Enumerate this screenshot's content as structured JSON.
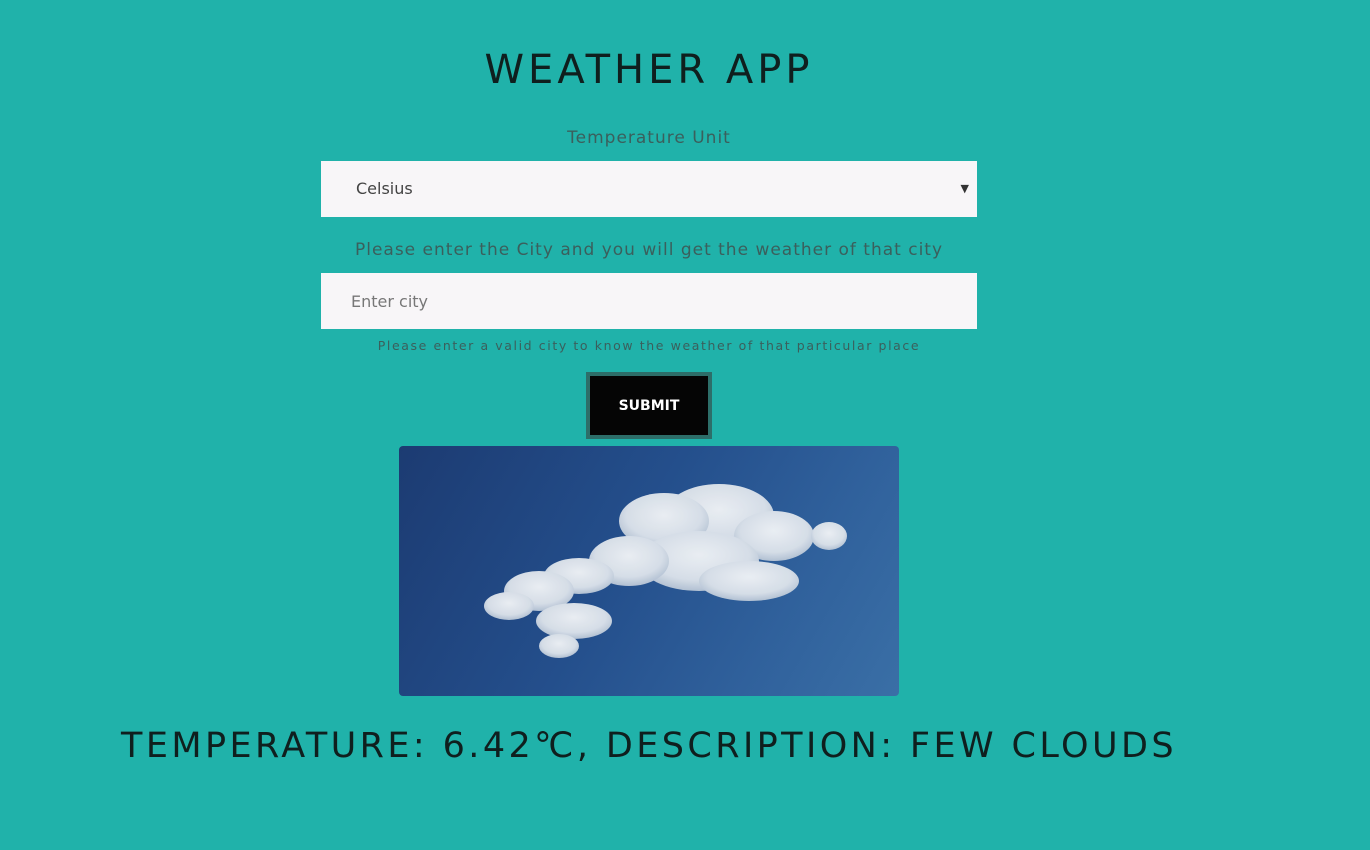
{
  "app": {
    "title": "WEATHER APP"
  },
  "unit": {
    "label": "Temperature Unit",
    "selected": "Celsius",
    "options": [
      "Celsius"
    ]
  },
  "city": {
    "label": "Please enter the City and you will get the weather of that city",
    "placeholder": "Enter city",
    "value": "",
    "hint": "Please enter a valid city to know the weather of that particular place"
  },
  "submit": {
    "label": "SUBMIT"
  },
  "weather_image": {
    "icon": "cloud-photo",
    "sky_color": "#244f8c",
    "cloud_color": "#eef1f4"
  },
  "result": {
    "text": "TEMPERATURE: 6.42℃, DESCRIPTION: FEW CLOUDS"
  },
  "colors": {
    "background": "#20b2aa",
    "button": "#050505",
    "button_border": "#2d6e69",
    "field": "#f8f6f8"
  }
}
